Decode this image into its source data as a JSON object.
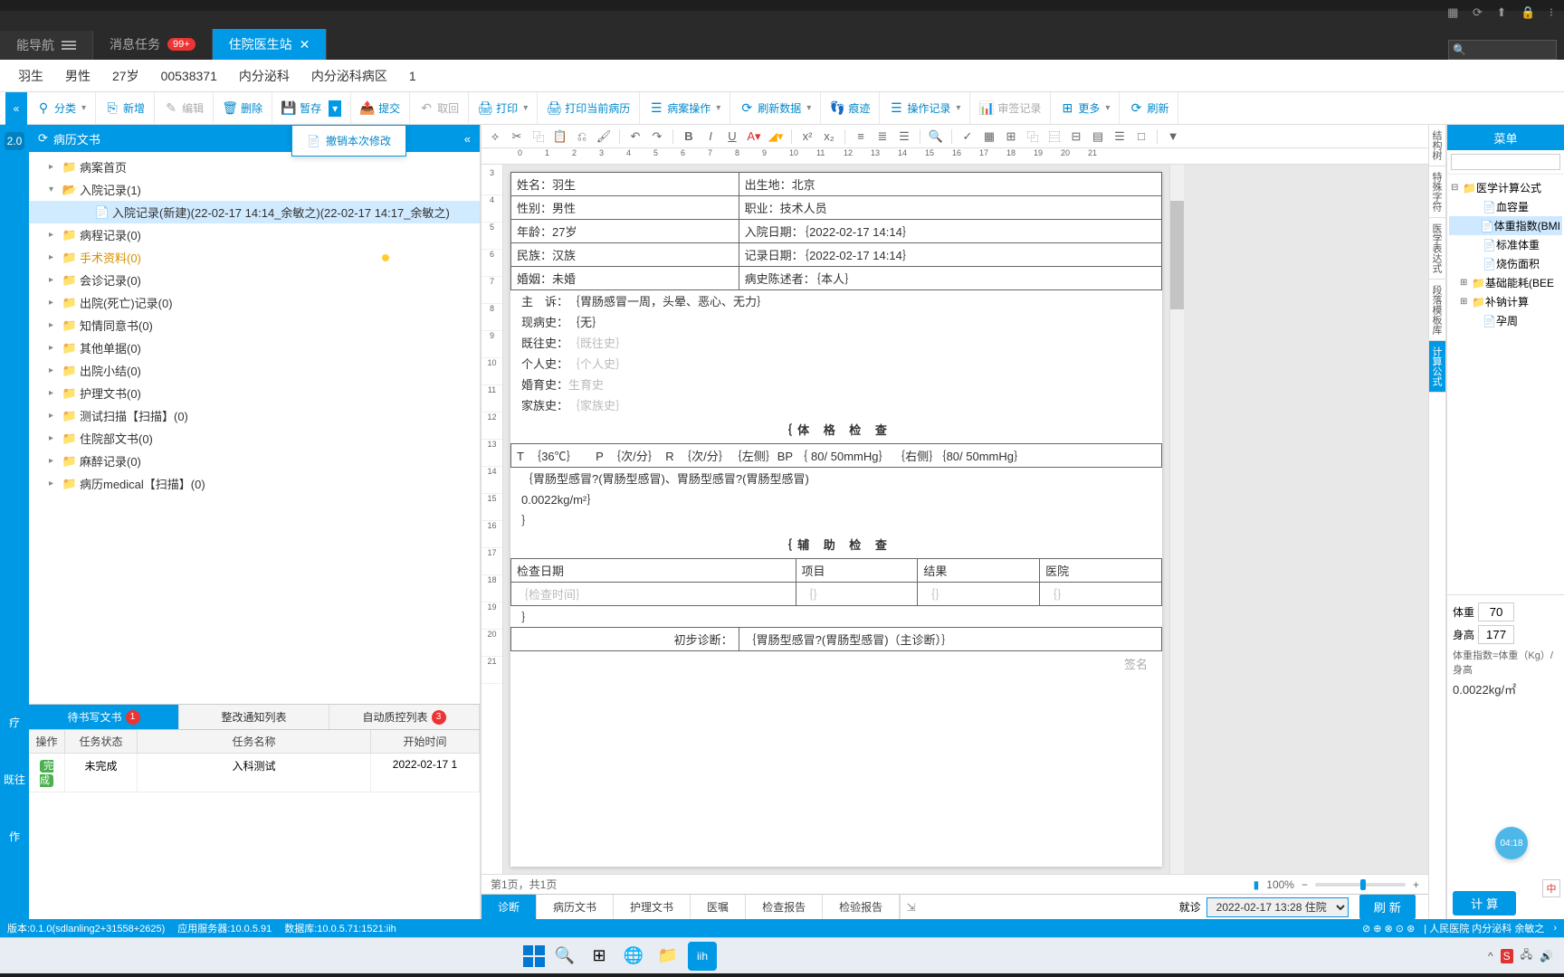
{
  "top_icons": "▦ ⟳ ⬆ 🔒 ⁝",
  "tabs": {
    "nav": "能导航",
    "msg": "消息任务",
    "msg_badge": "99+",
    "active": "住院医生站"
  },
  "patient": {
    "name": "羽生",
    "sex": "男性",
    "age": "27岁",
    "id": "00538371",
    "dept": "内分泌科",
    "ward": "内分泌科病区",
    "bed": "1"
  },
  "toolbar": {
    "classify": "分类",
    "add": "新增",
    "edit": "编辑",
    "del": "删除",
    "save": "暂存",
    "undo_menu": "撤销本次修改",
    "submit": "提交",
    "cancel": "取回",
    "print": "打印",
    "print_cur": "打印当前病历",
    "record_op": "病案操作",
    "refresh_data": "刷新数据",
    "trace": "痕迹",
    "op_log": "操作记录",
    "sign_log": "审签记录",
    "more": "更多",
    "refresh": "刷新"
  },
  "tree": {
    "header": "病历文书",
    "items": [
      {
        "label": "病案首页",
        "icon": "folder",
        "lvl": 1
      },
      {
        "label": "入院记录(1)",
        "icon": "folder-open",
        "lvl": 1,
        "tog": "▾"
      },
      {
        "label": "入院记录(新建)(22-02-17 14:14_余敏之)(22-02-17 14:17_余敏之)",
        "icon": "file",
        "lvl": 3,
        "sel": true
      },
      {
        "label": "病程记录(0)",
        "icon": "folder",
        "lvl": 1
      },
      {
        "label": "手术资料(0)",
        "icon": "folder",
        "lvl": 1,
        "hi": true,
        "dot": true
      },
      {
        "label": "会诊记录(0)",
        "icon": "folder",
        "lvl": 1
      },
      {
        "label": "出院(死亡)记录(0)",
        "icon": "folder",
        "lvl": 1
      },
      {
        "label": "知情同意书(0)",
        "icon": "folder",
        "lvl": 1
      },
      {
        "label": "其他单据(0)",
        "icon": "folder",
        "lvl": 1
      },
      {
        "label": "出院小结(0)",
        "icon": "folder",
        "lvl": 1
      },
      {
        "label": "护理文书(0)",
        "icon": "folder",
        "lvl": 1
      },
      {
        "label": "测试扫描【扫描】(0)",
        "icon": "folder",
        "lvl": 1
      },
      {
        "label": "住院部文书(0)",
        "icon": "folder",
        "lvl": 1
      },
      {
        "label": "麻醉记录(0)",
        "icon": "folder",
        "lvl": 1
      },
      {
        "label": "病历medical【扫描】(0)",
        "icon": "folder",
        "lvl": 1
      }
    ]
  },
  "left_strip": {
    "ver": "2.0",
    "i1": "疗",
    "i2": "既往",
    "i3": "作"
  },
  "tree_tabs": {
    "t1": "待书写文书",
    "t1b": "1",
    "t2": "整改通知列表",
    "t3": "自动质控列表",
    "t3b": "3"
  },
  "tasktable": {
    "h_op": "操作",
    "h_st": "任务状态",
    "h_nm": "任务名称",
    "h_tm": "开始时间",
    "r_op": "完成",
    "r_st": "未完成",
    "r_nm": "入科测试",
    "r_tm": "2022-02-17 1"
  },
  "editor": {
    "page_status": "第1页，共1页",
    "zoom": "100%"
  },
  "doc": {
    "name_l": "姓名：",
    "name_v": "羽生",
    "birthplace_l": "出生地：",
    "birthplace_v": "北京",
    "sex_l": "性别：",
    "sex_v": "男性",
    "job_l": "职业：",
    "job_v": "技术人员",
    "age_l": "年龄：",
    "age_v": "27岁",
    "admit_l": "入院日期：",
    "admit_v": "｛2022-02-17 14:14｝",
    "nation_l": "民族：",
    "nation_v": "汉族",
    "record_l": "记录日期：",
    "record_v": "｛2022-02-17 14:14｝",
    "marry_l": "婚姻：",
    "marry_v": "未婚",
    "narrator_l": "病史陈述者：",
    "narrator_v": "｛本人｝",
    "chief_l": "主　诉：",
    "chief_v": "｛胃肠感冒一周，头晕、恶心、无力｝",
    "present_l": "现病史：",
    "present_v": "｛无｝",
    "past_l": "既往史：",
    "past_v": "｛既往史｝",
    "personal_l": "个人史：",
    "personal_v": "｛个人史｝",
    "fertility_l": "婚育史：",
    "fertility_v": "生育史",
    "family_l": "家族史：",
    "family_v": "｛家族史｝",
    "physical_hdr": "｛体 格 检 查",
    "vital": "T　｛36℃｝　　P　｛次/分｝　R　｛次/分｝　｛左侧｝BP ｛ 80/ 50mmHg｝ ｛右侧｝｛80/ 50mmHg｝",
    "vital2": "｛胃肠型感冒?(胃肠型感冒)、胃肠型感冒?(胃肠型感冒)",
    "vital3": "0.0022kg/m²｝",
    "aux_hdr": "｛辅 助 检 查",
    "aux_h1": "检查日期",
    "aux_h2": "项目",
    "aux_h3": "结果",
    "aux_h4": "医院",
    "aux_r1": "｛检查时间｝",
    "aux_r2": "｛｝",
    "aux_r3": "｛｝",
    "aux_r4": "｛｝",
    "diag_l": "初步诊断：",
    "diag_v": "｛胃肠型感冒?(胃肠型感冒)（主诊断）｝",
    "sign": "签名"
  },
  "struct_tabs": [
    "结构树",
    "特殊字符",
    "医学表达式",
    "段落模板库",
    "计算公式"
  ],
  "menu": {
    "header": "菜单",
    "root": "医学计算公式",
    "items": [
      {
        "label": "血容量",
        "lvl": 2
      },
      {
        "label": "体重指数(BMI",
        "lvl": 2,
        "sel": true
      },
      {
        "label": "标准体重",
        "lvl": 2
      },
      {
        "label": "烧伤面积",
        "lvl": 2
      },
      {
        "label": "基础能耗(BEE",
        "lvl": 1,
        "tog": "⊞",
        "folder": true
      },
      {
        "label": "补钠计算",
        "lvl": 1,
        "tog": "⊞",
        "folder": true
      },
      {
        "label": "孕周",
        "lvl": 2
      }
    ],
    "calc": {
      "weight_l": "体重",
      "weight_v": "70",
      "height_l": "身高",
      "height_v": "177",
      "formula": "体重指数=体重（Kg）/身高",
      "result": "0.0022kg/㎡",
      "btn": "计 算"
    }
  },
  "doctabs": {
    "t1": "诊断",
    "t2": "病历文书",
    "t3": "护理文书",
    "t4": "医嘱",
    "t5": "检查报告",
    "t6": "检验报告",
    "visit_l": "就诊",
    "visit_v": "2022-02-17 13:28 住院",
    "refresh": "刷 新"
  },
  "footer": {
    "ver": "版本:0.1.0(sdlanling2+31558+2625)",
    "app": "应用服务器:10.0.5.91",
    "db": "数据库:10.0.5.71:1521:iih",
    "org": "| 人民医院 内分泌科 余敏之"
  },
  "floaty": "04:18",
  "lang": "中"
}
